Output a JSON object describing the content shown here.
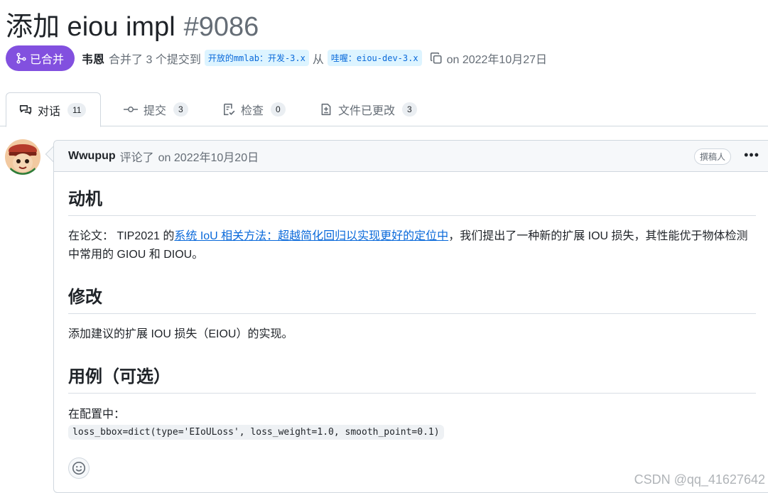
{
  "pr": {
    "title": "添加 eiou impl",
    "number": "#9086",
    "state": "已合并",
    "author": "韦恩",
    "merge_text": "合并了 3 个提交到",
    "base_branch": "开放的mmlab：开发-3.x",
    "from_text": "从",
    "head_branch": "哇喔：eiou-dev-3.x",
    "date_text": "on 2022年10月27日"
  },
  "tabs": [
    {
      "label": "对话",
      "count": "11",
      "icon": "conversation-icon"
    },
    {
      "label": "提交",
      "count": "3",
      "icon": "commit-icon"
    },
    {
      "label": "检查",
      "count": "0",
      "icon": "checklist-icon"
    },
    {
      "label": "文件已更改",
      "count": "3",
      "icon": "file-diff-icon"
    }
  ],
  "comment": {
    "author": "Wwupup",
    "action": "评论了",
    "date": "on 2022年10月20日",
    "role": "撰稿人",
    "sections": {
      "motivation_heading": "动机",
      "motivation_prefix": "在论文： TIP2021 的",
      "motivation_link": "系统 IoU 相关方法：超越简化回归以实现更好的定位中",
      "motivation_suffix": "，我们提出了一种新的扩展 IOU 损失，其性能优于物体检测中常用的 GIOU 和 DIOU。",
      "modification_heading": "修改",
      "modification_text": "添加建议的扩展 IOU 损失（EIOU）的实现。",
      "usage_heading": "用例（可选）",
      "usage_text": "在配置中：",
      "usage_code": "loss_bbox=dict(type='EIoULoss',  loss_weight=1.0, smooth_point=0.1)"
    }
  },
  "watermark": "CSDN @qq_41627642",
  "colors": {
    "merged": "#8250df",
    "link": "#0969da",
    "branch_bg": "#ddf4ff",
    "border": "#d0d7de"
  }
}
